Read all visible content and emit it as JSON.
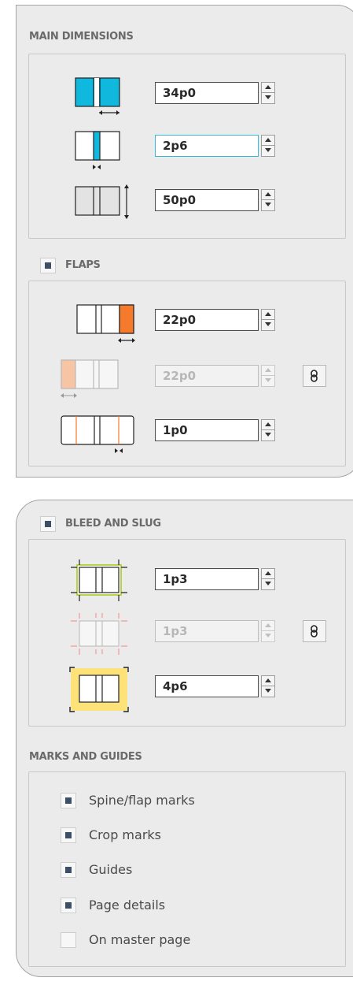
{
  "main_dimensions": {
    "title": "MAIN DIMENSIONS",
    "width": {
      "value": "34p0"
    },
    "spine": {
      "value": "2p6"
    },
    "height": {
      "value": "50p0"
    }
  },
  "flaps": {
    "title": "FLAPS",
    "enabled": true,
    "front_flap": {
      "value": "22p0"
    },
    "back_flap": {
      "value": "22p0",
      "disabled": true
    },
    "fold_gap": {
      "value": "1p0"
    }
  },
  "bleed_slug": {
    "title": "BLEED AND SLUG",
    "enabled": true,
    "bleed": {
      "value": "1p3"
    },
    "bleed_linked": {
      "value": "1p3",
      "disabled": true
    },
    "slug": {
      "value": "4p6"
    }
  },
  "marks_guides": {
    "title": "MARKS AND GUIDES",
    "items": [
      {
        "label": "Spine/flap marks",
        "checked": true
      },
      {
        "label": "Crop marks",
        "checked": true
      },
      {
        "label": "Guides",
        "checked": true
      },
      {
        "label": "Page details",
        "checked": true
      },
      {
        "label": "On master page",
        "checked": false
      }
    ]
  },
  "colors": {
    "accent_blue": "#11b8dd",
    "accent_orange": "#f57a2c",
    "slug_yellow": "#fde179",
    "bleed_green": "#a8cc1f"
  },
  "icons": [
    "link-chain-icon",
    "width-arrow-icon",
    "height-arrow-icon"
  ]
}
